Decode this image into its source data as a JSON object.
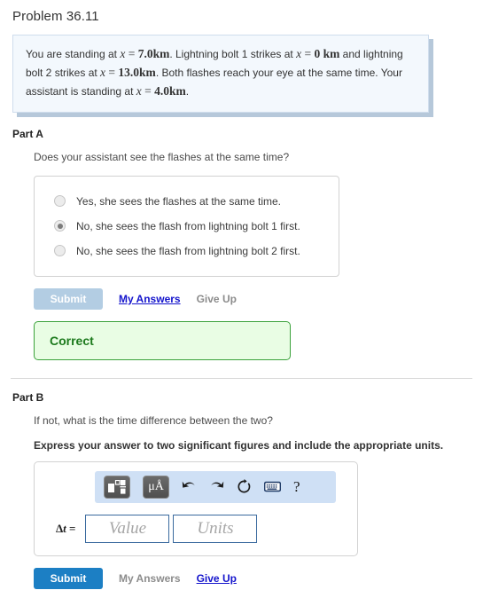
{
  "problem": {
    "title": "Problem 36.11",
    "statement_segments": [
      {
        "type": "text",
        "text": "You are standing at "
      },
      {
        "type": "math_italic",
        "text": "x"
      },
      {
        "type": "math",
        "text": " = "
      },
      {
        "type": "math_bold",
        "text": "7.0km"
      },
      {
        "type": "text",
        "text": ". Lightning bolt 1 strikes at "
      },
      {
        "type": "math_italic",
        "text": "x"
      },
      {
        "type": "math",
        "text": " = "
      },
      {
        "type": "math_bold",
        "text": "0 km"
      },
      {
        "type": "text",
        "text": " and lightning bolt 2 strikes at "
      },
      {
        "type": "math_italic",
        "text": "x"
      },
      {
        "type": "math",
        "text": " = "
      },
      {
        "type": "math_bold",
        "text": "13.0km"
      },
      {
        "type": "text",
        "text": ". Both flashes reach your eye at the same time. Your assistant is standing at "
      },
      {
        "type": "math_italic",
        "text": "x"
      },
      {
        "type": "math",
        "text": " = "
      },
      {
        "type": "math_bold",
        "text": "4.0km"
      },
      {
        "type": "text",
        "text": "."
      }
    ],
    "statement_plain": "You are standing at x = 7.0km. Lightning bolt 1 strikes at x = 0 km and lightning bolt 2 strikes at x = 13.0km. Both flashes reach your eye at the same time. Your assistant is standing at x = 4.0km."
  },
  "part_a": {
    "label": "Part A",
    "question": "Does your assistant see the flashes at the same time?",
    "choices": [
      {
        "label": "Yes, she sees the flashes at the same time.",
        "selected": false
      },
      {
        "label": "No, she sees the flash from lightning bolt 1 first.",
        "selected": true
      },
      {
        "label": "No, she sees the flash from lightning bolt 2 first.",
        "selected": false
      }
    ],
    "submit_label": "Submit",
    "submit_enabled": false,
    "my_answers_label": "My Answers",
    "my_answers_is_link": true,
    "give_up_label": "Give Up",
    "give_up_is_link": false,
    "feedback": "Correct"
  },
  "part_b": {
    "label": "Part B",
    "question": "If not, what is the time difference between the two?",
    "instruction": "Express your answer to two significant figures and include the appropriate units.",
    "toolbar": [
      {
        "name": "template-icon",
        "label": "Math templates"
      },
      {
        "name": "units-icon",
        "label": "μÅ"
      },
      {
        "name": "undo-icon",
        "label": "Undo"
      },
      {
        "name": "redo-icon",
        "label": "Redo"
      },
      {
        "name": "reset-icon",
        "label": "Reset"
      },
      {
        "name": "keyboard-icon",
        "label": "Keyboard shortcuts"
      },
      {
        "name": "help-icon",
        "label": "?"
      }
    ],
    "answer_prefix_delta": "Δ",
    "answer_prefix_var": "t",
    "answer_prefix_eq": " =",
    "value_placeholder": "Value",
    "units_placeholder": "Units",
    "value_text": "",
    "units_text": "",
    "submit_label": "Submit",
    "submit_enabled": true,
    "my_answers_label": "My Answers",
    "my_answers_is_link": false,
    "give_up_label": "Give Up",
    "give_up_is_link": true
  },
  "colors": {
    "statement_bg": "#f3f8fd",
    "statement_border": "#cfdded",
    "statement_shadow": "#b6c8da",
    "submit_active": "#1c7fc4",
    "submit_disabled": "#b3cde3",
    "link_blue": "#1414cc",
    "correct_bg": "#e9fde4",
    "correct_border": "#3ba23b",
    "correct_text": "#1d7a1d",
    "toolbar_bg": "#cfe0f5",
    "field_border": "#39699e"
  }
}
